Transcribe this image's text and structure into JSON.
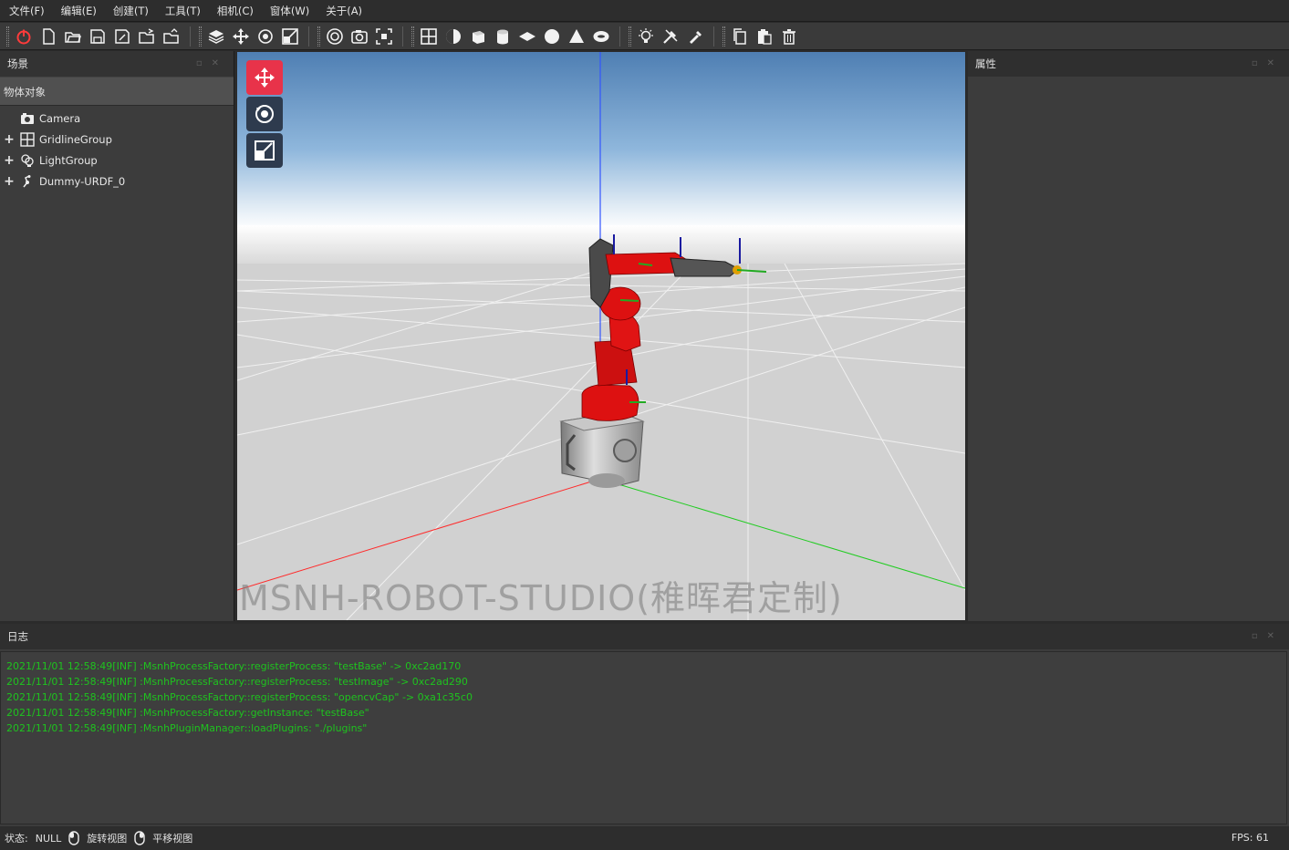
{
  "menu": [
    "文件(F)",
    "编辑(E)",
    "创建(T)",
    "工具(T)",
    "相机(C)",
    "窗体(W)",
    "关于(A)"
  ],
  "toolbar": {
    "groups": [
      [
        "power-icon",
        "new-file-icon",
        "open-folder-icon",
        "save-icon",
        "save-as-icon",
        "open-project-icon",
        "export-icon"
      ],
      [
        "layers-icon",
        "move-icon",
        "rotate-icon",
        "scale-icon"
      ],
      [
        "camera-view-icon",
        "camera-snapshot-icon",
        "fit-view-icon"
      ],
      [
        "grid-icon",
        "sphere-icon",
        "cube-icon",
        "cylinder-icon",
        "plane-icon",
        "circle-icon",
        "cone-icon",
        "torus-icon"
      ],
      [
        "light-icon",
        "tools-icon",
        "pen-icon"
      ],
      [
        "copy-icon",
        "paste-icon",
        "delete-icon"
      ]
    ]
  },
  "scene_panel": {
    "title": "场景",
    "tree_header": "物体对象",
    "items": [
      {
        "label": "Camera",
        "icon": "camera-icon",
        "expandable": false
      },
      {
        "label": "GridlineGroup",
        "icon": "grid-group-icon",
        "expandable": true
      },
      {
        "label": "LightGroup",
        "icon": "light-group-icon",
        "expandable": true
      },
      {
        "label": "Dummy-URDF_0",
        "icon": "urdf-icon",
        "expandable": true
      }
    ]
  },
  "viewport": {
    "watermark": "MSNH-ROBOT-STUDIO(稚晖君定制)",
    "tools": [
      "move-tool-icon",
      "rotate-tool-icon",
      "scale-tool-icon"
    ],
    "colors": {
      "active_tool": "#e8334a",
      "tool": "#2e3b4e",
      "robot": "#dd1111",
      "x_axis": "#ff2020",
      "y_axis": "#22cc22",
      "z_axis": "#2040ff"
    }
  },
  "props_panel": {
    "title": "属性"
  },
  "log_panel": {
    "title": "日志",
    "lines": [
      "2021/11/01 12:58:49[INF] :MsnhProcessFactory::registerProcess: \"testBase\" -> 0xc2ad170",
      "2021/11/01 12:58:49[INF] :MsnhProcessFactory::registerProcess: \"testImage\" -> 0xc2ad290",
      "2021/11/01 12:58:49[INF] :MsnhProcessFactory::registerProcess: \"opencvCap\" -> 0xa1c35c0",
      "2021/11/01 12:58:49[INF] :MsnhProcessFactory::getInstance: \"testBase\"",
      "2021/11/01 12:58:49[INF] :MsnhPluginManager::loadPlugins: \"./plugins\""
    ],
    "color": "#1ec31e"
  },
  "status": {
    "label": "状态:",
    "value": "NULL",
    "rotate_label": "旋转视图",
    "pan_label": "平移视图",
    "fps": "FPS: 61"
  }
}
